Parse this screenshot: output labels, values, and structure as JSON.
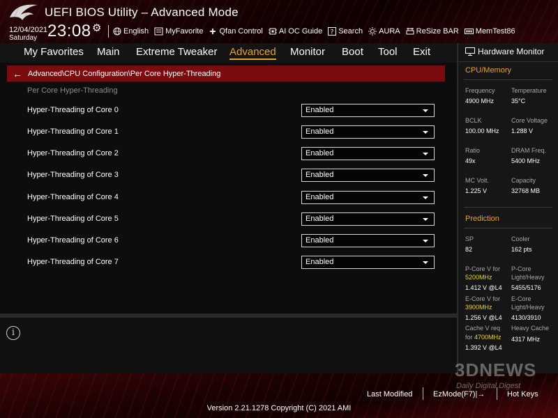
{
  "header": {
    "title": "UEFI BIOS Utility – Advanced Mode",
    "date": "12/04/2021",
    "weekday": "Saturday",
    "time": "23:08",
    "tools": [
      {
        "label": "English",
        "icon": "globe-icon"
      },
      {
        "label": "MyFavorite",
        "icon": "favorite-icon"
      },
      {
        "label": "Qfan Control",
        "icon": "fan-icon"
      },
      {
        "label": "AI OC Guide",
        "icon": "ai-icon"
      },
      {
        "label": "Search",
        "icon": "search-icon"
      },
      {
        "label": "AURA",
        "icon": "aura-icon"
      },
      {
        "label": "ReSize BAR",
        "icon": "resize-bar-icon"
      },
      {
        "label": "MemTest86",
        "icon": "memtest-icon"
      }
    ]
  },
  "tabs": [
    "My Favorites",
    "Main",
    "Extreme Tweaker",
    "Advanced",
    "Monitor",
    "Boot",
    "Tool",
    "Exit"
  ],
  "active_tab": "Advanced",
  "breadcrumb": "Advanced\\CPU Configuration\\Per Core Hyper-Threading",
  "main": {
    "section_label": "Per Core Hyper-Threading",
    "rows": [
      {
        "label": "Hyper-Threading of Core 0",
        "value": "Enabled"
      },
      {
        "label": "Hyper-Threading of Core 1",
        "value": "Enabled"
      },
      {
        "label": "Hyper-Threading of Core 2",
        "value": "Enabled"
      },
      {
        "label": "Hyper-Threading of Core 3",
        "value": "Enabled"
      },
      {
        "label": "Hyper-Threading of Core 4",
        "value": "Enabled"
      },
      {
        "label": "Hyper-Threading of Core 5",
        "value": "Enabled"
      },
      {
        "label": "Hyper-Threading of Core 6",
        "value": "Enabled"
      },
      {
        "label": "Hyper-Threading of Core 7",
        "value": "Enabled"
      }
    ]
  },
  "help": {
    "icon": "info-icon"
  },
  "hardware_monitor": {
    "title": "Hardware Monitor",
    "cpu_memory_title": "CPU/Memory",
    "frequency_label": "Frequency",
    "frequency_value": "4900 MHz",
    "temperature_label": "Temperature",
    "temperature_value": "35°C",
    "bclk_label": "BCLK",
    "bclk_value": "100.00 MHz",
    "core_voltage_label": "Core Voltage",
    "core_voltage_value": "1.288 V",
    "ratio_label": "Ratio",
    "ratio_value": "49x",
    "dram_freq_label": "DRAM Freq.",
    "dram_freq_value": "5400 MHz",
    "mc_volt_label": "MC Volt.",
    "mc_volt_value": "1.225 V",
    "capacity_label": "Capacity",
    "capacity_value": "32768 MB",
    "prediction_title": "Prediction",
    "sp_label": "SP",
    "sp_value": "82",
    "cooler_label": "Cooler",
    "cooler_value": "162 pts",
    "pcore_v_label": "P-Core V for",
    "pcore_v_freq": "5200MHz",
    "pcore_v_value": "1.412 V @L4",
    "pcore_lh_label1": "P-Core",
    "pcore_lh_label2": "Light/Heavy",
    "pcore_lh_value": "5455/5176",
    "ecore_v_label": "E-Core V for",
    "ecore_v_freq": "3900MHz",
    "ecore_v_value": "1.256 V @L4",
    "ecore_lh_label1": "E-Core",
    "ecore_lh_label2": "Light/Heavy",
    "ecore_lh_value": "4130/3910",
    "cache_v_label1": "Cache V req",
    "cache_v_label2": "for",
    "cache_v_freq": "4700MHz",
    "cache_v_value": "1.392 V @L4",
    "heavy_cache_label": "Heavy Cache",
    "heavy_cache_value": "4317 MHz"
  },
  "footer": {
    "last_modified": "Last Modified",
    "ezmode": "EzMode(F7)|→",
    "hot_keys": "Hot Keys",
    "version": "Version 2.21.1278 Copyright (C) 2021 AMI"
  },
  "watermark": {
    "big": "3DNEWS",
    "small": "Daily Digital Digest"
  },
  "colors": {
    "accent": "#e5a52b",
    "highlight": "#f3d331",
    "breadcrumb_bg": "#7a0c10",
    "brand_red": "#a0141a"
  }
}
